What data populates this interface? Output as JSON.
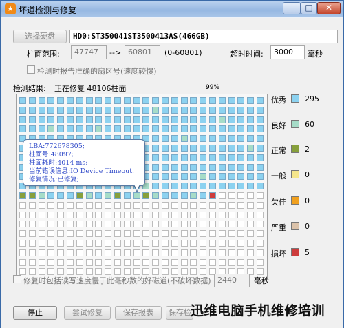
{
  "window": {
    "title": "坏道检测与修复",
    "app_icon_glyph": "★",
    "minimize_label": "—",
    "maximize_label": "□",
    "close_label": "✕"
  },
  "disk": {
    "select_label": "选择硬盘",
    "name": "HD0:ST350041ST3500413AS(466GB)"
  },
  "range": {
    "label": "柱面范围:",
    "start": "47747",
    "arrow": "-->",
    "end": "60801",
    "bounds": "(0-60801)"
  },
  "timeout": {
    "label": "超时时间:",
    "value": "3000",
    "unit": "毫秒"
  },
  "options": {
    "report_sector": "检测时报告准确的扇区号(速度较慢)",
    "repair_slow": "修复时包括读写速度慢于此毫秒数的好磁道(不破坏数据)",
    "slow_ms_value": "2440",
    "slow_ms_unit": "毫秒"
  },
  "status": {
    "result_label": "检测结果:",
    "current_text": "正在修复 48106柱面",
    "percent_text": "99%"
  },
  "tooltip": {
    "lba": "LBA:772678305;",
    "cylinder": "柱面号:48097;",
    "time": "柱面耗时:4014 ms;",
    "error": "当前错误信息:IO Device Timeout.",
    "repair": "修复情况:已修复;"
  },
  "legend": [
    {
      "name": "优秀",
      "count": "295",
      "color": "#8cd2f0"
    },
    {
      "name": "良好",
      "count": "60",
      "color": "#a6dcc8"
    },
    {
      "name": "正常",
      "count": "2",
      "color": "#87a03c"
    },
    {
      "name": "一般",
      "count": "0",
      "color": "#f5e68c"
    },
    {
      "name": "欠佳",
      "count": "0",
      "color": "#f0a01e"
    },
    {
      "name": "严重",
      "count": "0",
      "color": "#dcc3aa"
    },
    {
      "name": "损坏",
      "count": "5",
      "color": "#cd3c3c"
    }
  ],
  "grid": {
    "empty_color": "#ffffff",
    "columns": 26,
    "rows": 19,
    "rows_filled": 11,
    "last_row_filled": 21,
    "good_cells": [
      [
        1,
        14
      ],
      [
        2,
        21
      ],
      [
        3,
        3
      ],
      [
        3,
        8
      ],
      [
        4,
        17
      ],
      [
        5,
        24
      ],
      [
        6,
        11
      ],
      [
        7,
        5
      ],
      [
        8,
        19
      ],
      [
        9,
        13
      ],
      [
        10,
        2
      ],
      [
        10,
        7
      ],
      [
        10,
        9
      ],
      [
        10,
        12
      ],
      [
        10,
        14
      ],
      [
        10,
        18
      ],
      [
        10,
        20
      ],
      [
        10,
        22
      ],
      [
        10,
        24
      ]
    ],
    "normal_cells": [
      [
        10,
        0
      ],
      [
        10,
        1
      ],
      [
        10,
        6
      ],
      [
        10,
        10
      ],
      [
        10,
        13
      ]
    ],
    "damaged_cells": [
      [
        10,
        20
      ]
    ]
  },
  "buttons": {
    "stop": "停止",
    "try_repair": "尝试修复",
    "save_report": "保存报表",
    "save_image": "保存检"
  },
  "watermark": "迅维电脑手机维修培训"
}
